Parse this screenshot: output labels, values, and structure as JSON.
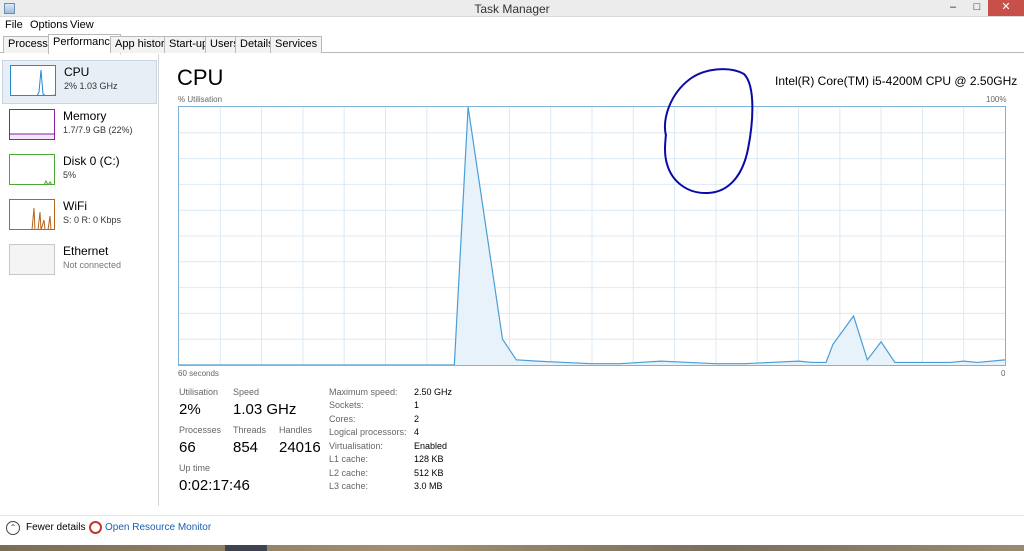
{
  "window": {
    "title": "Task Manager",
    "min_glyph": "‒",
    "max_glyph": "□",
    "close_glyph": "✕"
  },
  "menu": [
    "File",
    "Options",
    "View"
  ],
  "tabs": [
    "Processes",
    "Performance",
    "App history",
    "Start-up",
    "Users",
    "Details",
    "Services"
  ],
  "active_tab": "Performance",
  "sidebar": {
    "items": [
      {
        "name": "CPU",
        "detail": "2% 1.03 GHz",
        "color": "#1f8bd1",
        "selected": true
      },
      {
        "name": "Memory",
        "detail": "1.7/7.9 GB (22%)",
        "color": "#8b1fa9",
        "selected": false
      },
      {
        "name": "Disk 0 (C:)",
        "detail": "5%",
        "color": "#4da832",
        "selected": false
      },
      {
        "name": "WiFi",
        "detail": "S: 0 R: 0 Kbps",
        "color": "#b5651d",
        "selected": false
      },
      {
        "name": "Ethernet",
        "detail": "Not connected",
        "color": "#c8c8c8",
        "selected": false
      }
    ]
  },
  "main": {
    "title": "CPU",
    "model": "Intel(R) Core(TM) i5-4200M CPU @ 2.50GHz",
    "graph_label_tl": "% Utilisation",
    "graph_label_tr": "100%",
    "graph_label_bl": "60 seconds",
    "graph_label_br": "0",
    "graph_line_color": "#4a9ed6",
    "graph_fill_color": "#e8f2fa",
    "graph_grid_color": "#dbe9f4",
    "annotation_color": "#0a0aa8"
  },
  "stats": {
    "utilisation_label": "Utilisation",
    "utilisation_value": "2%",
    "speed_label": "Speed",
    "speed_value": "1.03 GHz",
    "processes_label": "Processes",
    "processes_value": "66",
    "threads_label": "Threads",
    "threads_value": "854",
    "handles_label": "Handles",
    "handles_value": "24016",
    "uptime_label": "Up time",
    "uptime_value": "0:02:17:46"
  },
  "specs": [
    {
      "label": "Maximum speed:",
      "value": "2.50 GHz"
    },
    {
      "label": "Sockets:",
      "value": "1"
    },
    {
      "label": "Cores:",
      "value": "2"
    },
    {
      "label": "Logical processors:",
      "value": "4"
    },
    {
      "label": "Virtualisation:",
      "value": "Enabled"
    },
    {
      "label": "L1 cache:",
      "value": "128 KB"
    },
    {
      "label": "L2 cache:",
      "value": "512 KB"
    },
    {
      "label": "L3 cache:",
      "value": "3.0 MB"
    }
  ],
  "footer": {
    "fewer_details": "Fewer details",
    "open_resource_monitor": "Open Resource Monitor"
  },
  "chart_data": {
    "type": "area",
    "x": [
      60,
      40,
      39,
      36.5,
      35.5,
      34,
      32,
      30,
      28,
      26.5,
      25,
      23,
      21,
      19,
      17,
      15,
      14,
      13,
      12.5,
      11,
      10,
      9,
      8,
      6.5,
      4,
      3,
      2,
      0
    ],
    "y": [
      0,
      0,
      100,
      10,
      2,
      1.5,
      1,
      0.5,
      0.5,
      1,
      1.5,
      1,
      0.5,
      0.5,
      1,
      1.5,
      1,
      1,
      8,
      19,
      2,
      9,
      1,
      1,
      1,
      1.5,
      1,
      2
    ],
    "xlim": [
      60,
      0
    ],
    "ylim": [
      0,
      100
    ],
    "grid": true
  }
}
